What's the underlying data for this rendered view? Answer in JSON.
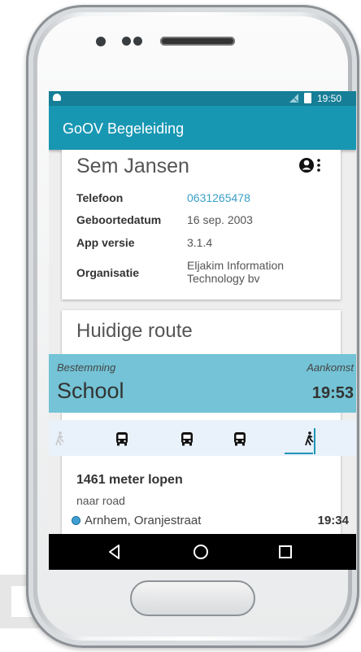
{
  "status_bar": {
    "time": "19:50"
  },
  "app_bar": {
    "title": "GoOV Begeleiding"
  },
  "profile": {
    "name": "Sem Jansen",
    "fields": [
      {
        "label": "Telefoon",
        "value": "0631265478"
      },
      {
        "label": "Geboortedatum",
        "value": "16 sep. 2003"
      },
      {
        "label": "App versie",
        "value": "3.1.4"
      },
      {
        "label": "Organisatie",
        "value_line1": "Eljakim Information",
        "value_line2": "Technology bv"
      }
    ]
  },
  "route": {
    "title": "Huidige route",
    "destination_label": "Bestemming",
    "arrival_label": "Aankomst",
    "destination": "School",
    "arrival_time": "19:53",
    "legs": [
      "walk-icon",
      "bus-icon",
      "bus-icon",
      "bus-icon",
      "walk-icon"
    ],
    "step": {
      "title": "1461 meter lopen",
      "subtitle": "naar road",
      "stop_name": "Arnhem, Oranjestraat",
      "stop_time": "19:34"
    }
  },
  "colors": {
    "status_bar": "#167e96",
    "app_bar": "#1897b3",
    "destination_bar": "#74c3d6",
    "link": "#3aa0c8"
  },
  "navigation": [
    "back-icon",
    "home-icon",
    "recents-icon"
  ]
}
